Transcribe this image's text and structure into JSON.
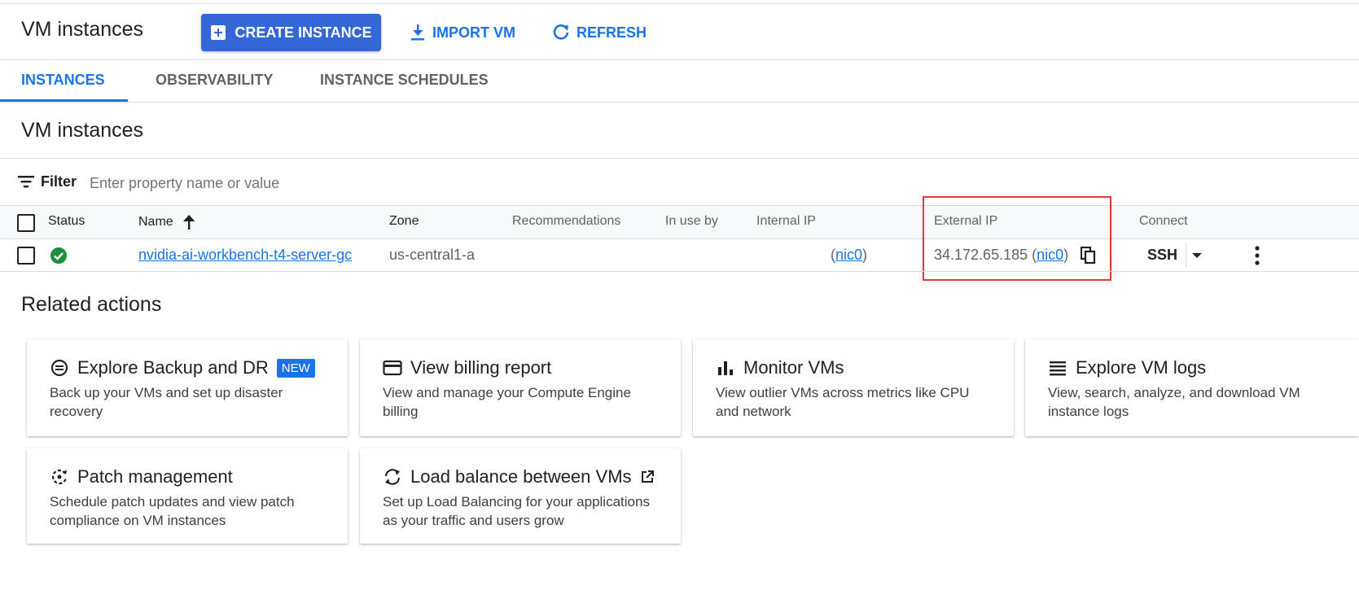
{
  "header": {
    "title": "VM instances",
    "create_label": "CREATE INSTANCE",
    "import_label": "IMPORT VM",
    "refresh_label": "REFRESH"
  },
  "tabs": [
    {
      "label": "INSTANCES",
      "active": true
    },
    {
      "label": "OBSERVABILITY",
      "active": false
    },
    {
      "label": "INSTANCE SCHEDULES",
      "active": false
    }
  ],
  "section_title": "VM instances",
  "filter": {
    "label": "Filter",
    "placeholder": "Enter property name or value"
  },
  "table": {
    "columns": [
      "Status",
      "Name",
      "Zone",
      "Recommendations",
      "In use by",
      "Internal IP",
      "External IP",
      "Connect"
    ],
    "rows": [
      {
        "status": "running",
        "name": "nvidia-ai-workbench-t4-server-gc",
        "zone": "us-central1-a",
        "recommendations": "",
        "in_use_by": "",
        "internal_ip_nic": "nic0",
        "external_ip": "34.172.65.185",
        "external_ip_nic": "nic0",
        "connect": "SSH"
      }
    ]
  },
  "related": {
    "title": "Related actions",
    "cards": [
      {
        "title": "Explore Backup and DR",
        "badge": "NEW",
        "desc_line1": "Back up your VMs and set up disaster",
        "desc_line2": "recovery",
        "icon": "backup-icon"
      },
      {
        "title": "View billing report",
        "desc_line1": "View and manage your Compute Engine",
        "desc_line2": "billing",
        "icon": "billing-icon"
      },
      {
        "title": "Monitor VMs",
        "desc_line1": "View outlier VMs across metrics like CPU",
        "desc_line2": "and network",
        "icon": "bar-chart-icon"
      },
      {
        "title": "Explore VM logs",
        "desc_line1": "View, search, analyze, and download VM",
        "desc_line2": "instance logs",
        "icon": "logs-icon"
      },
      {
        "title": "Patch management",
        "desc_line1": "Schedule patch updates and view patch",
        "desc_line2": "compliance on VM instances",
        "icon": "patch-icon"
      },
      {
        "title": "Load balance between VMs",
        "desc_line1": "Set up Load Balancing for your applications",
        "desc_line2": "as your traffic and users grow",
        "icon": "load-balance-icon"
      }
    ]
  },
  "colors": {
    "accent": "#1a73e8",
    "button": "#3367d6",
    "success": "#1e8e3e",
    "highlight": "#e53935"
  }
}
